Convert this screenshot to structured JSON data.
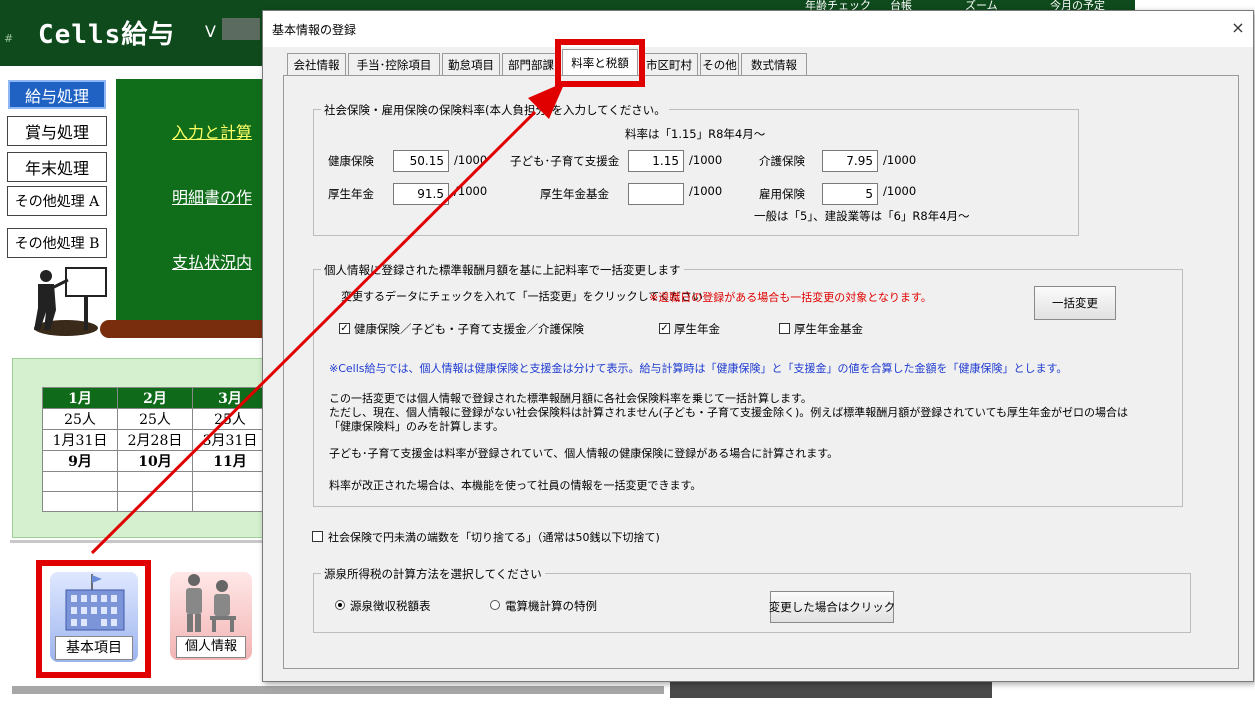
{
  "app": {
    "title": "Cells給与",
    "hash": "#",
    "version_prefix": "V",
    "header_right": [
      "年齢チェック",
      "台帳",
      "ズーム",
      "今月の予定"
    ],
    "left_menu": [
      "給与処理",
      "賞与処理",
      "年末処理",
      "その他処理 A",
      "その他処理 B"
    ],
    "main_links": [
      "入力と計算",
      "明細書の作",
      "支払状況内"
    ],
    "calendar": {
      "months": [
        "1月",
        "2月",
        "3月"
      ],
      "counts": [
        "25人",
        "25人",
        "25人"
      ],
      "dates": [
        "1月31日",
        "2月28日",
        "3月31日"
      ],
      "next_months": [
        "9月",
        "10月",
        "11月"
      ]
    },
    "bottom_buttons": {
      "kihon": "基本項目",
      "kojin": "個人情報"
    },
    "colors": {
      "header": "#0f4a1c",
      "panel": "#106d1a",
      "highlight": "#e00000",
      "active_menu": "#1f62c4"
    }
  },
  "dialog": {
    "title": "基本情報の登録",
    "close": "×",
    "tabs": [
      "会社情報",
      "手当･控除項目",
      "勤怠項目",
      "部門部課",
      "料率と税額",
      "市区町村",
      "その他",
      "数式情報"
    ],
    "selected_tab": "料率と税額",
    "insurance": {
      "group_title": "社会保険・雇用保険の保険料率(本人負担分)を入力してください。",
      "rate_note": "料率は「1.15」R8年4月～",
      "health_label": "健康保険",
      "health_value": "50.15",
      "health_unit": "/1000",
      "child_label": "子ども･子育て支援金",
      "child_value": "1.15",
      "child_unit": "/1000",
      "care_label": "介護保険",
      "care_value": "7.95",
      "care_unit": "/1000",
      "pension_label": "厚生年金",
      "pension_value": "91.5",
      "pension_unit": "/1000",
      "fund_label": "厚生年金基金",
      "fund_value": "",
      "fund_unit": "/1000",
      "employment_label": "雇用保険",
      "employment_value": "5",
      "employment_unit": "/1000",
      "employment_note": "一般は「5」、建設業等は「6」R8年4月～"
    },
    "bulk": {
      "group_title": "個人情報に登録された標準報酬月額を基に上記料率で一括変更します",
      "instruction": "変更するデータにチェックを入れて「一括変更」をクリックしてください",
      "warning": "※退職日の登録がある場合も一括変更の対象となります。",
      "button": "一括変更",
      "check_health_label": "健康保険／子ども・子育て支援金／介護保険",
      "check_health": true,
      "check_pension_label": "厚生年金",
      "check_pension": true,
      "check_fund_label": "厚生年金基金",
      "check_fund": false,
      "blue_note": "※Cells給与では、個人情報は健康保険と支援金は分けて表示。給与計算時は「健康保険」と「支援金」の値を合算した金額を「健康保険」とします。",
      "para1": "この一括変更では個人情報で登録された標準報酬月額に各社会保険料率を乗じて一括計算します。",
      "para2": "ただし、現在、個人情報に登録がない社会保険料は計算されません(子ども・子育て支援金除く)。例えば標準報酬月額が登録されていても厚生年金がゼロの場合は",
      "para3": "「健康保険料」のみを計算します。",
      "para4": "子ども･子育て支援金は料率が登録されていて、個人情報の健康保険に登録がある場合に計算されます。",
      "para5": "料率が改正された場合は、本機能を使って社員の情報を一括変更できます。"
    },
    "rounding": {
      "label": "社会保険で円未満の端数を「切り捨てる」（通常は50銭以下切捨て)",
      "checked": false
    },
    "tax": {
      "group_title": "源泉所得税の計算方法を選択してください",
      "option1": "源泉徴収税額表",
      "option1_selected": true,
      "option2": "電算機計算の特例",
      "option2_selected": false,
      "button": "変更した場合はクリック"
    }
  }
}
